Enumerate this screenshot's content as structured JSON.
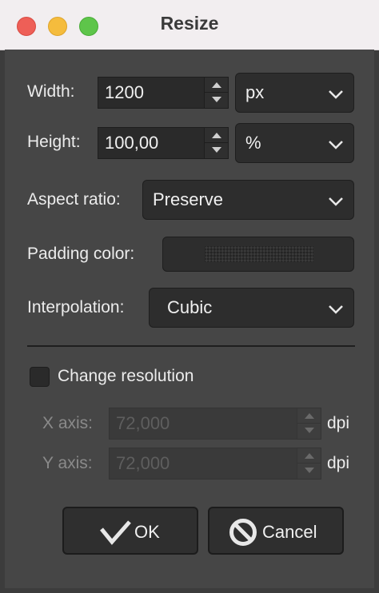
{
  "window": {
    "title": "Resize"
  },
  "width": {
    "label": "Width:",
    "value": "1200",
    "unit": "px"
  },
  "height": {
    "label": "Height:",
    "value": "100,00",
    "unit": "%"
  },
  "aspect_ratio": {
    "label": "Aspect ratio:",
    "value": "Preserve"
  },
  "padding_color": {
    "label": "Padding color:"
  },
  "interpolation": {
    "label": "Interpolation:",
    "value": "Cubic"
  },
  "change_resolution": {
    "label": "Change resolution",
    "checked": false
  },
  "x_axis": {
    "label": "X axis:",
    "value": "72,000",
    "unit": "dpi"
  },
  "y_axis": {
    "label": "Y axis:",
    "value": "72,000",
    "unit": "dpi"
  },
  "buttons": {
    "ok": "OK",
    "cancel": "Cancel"
  }
}
